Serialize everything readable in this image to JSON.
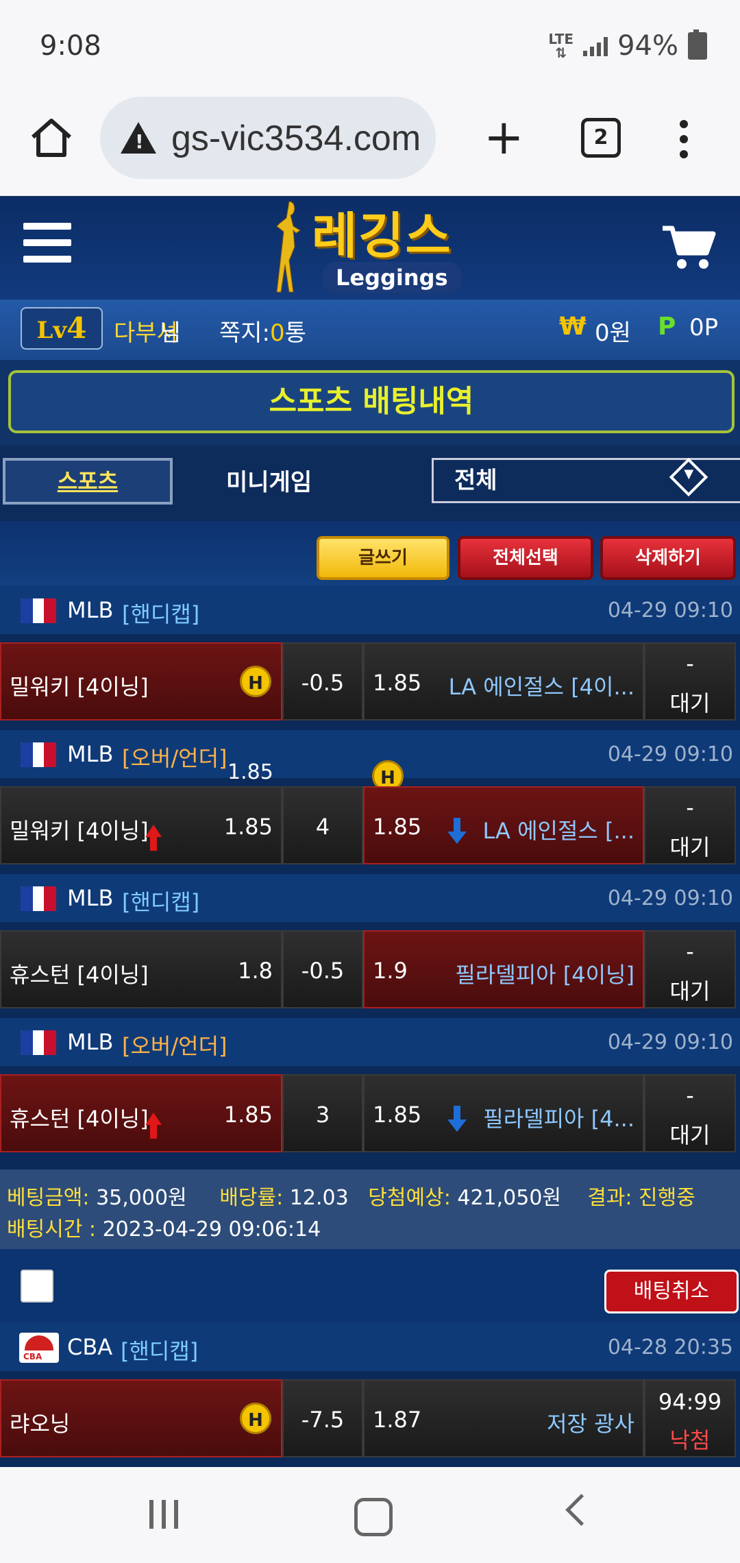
{
  "status": {
    "time": "9:08",
    "network": "LTE",
    "battery": "94%"
  },
  "browser": {
    "url": "gs-vic3534.com",
    "tab_count": "2"
  },
  "site": {
    "logo_kr": "레깅스",
    "logo_en": "Leggings"
  },
  "user": {
    "level_prefix": "Lv",
    "level": "4",
    "name": "다부셔",
    "name_suffix": "님",
    "msg_label": "쪽지:",
    "msg_count": "0",
    "msg_suffix": "통",
    "won_symbol": "₩",
    "money": "0원",
    "point_symbol": "P",
    "points": "0P"
  },
  "page_title": "스포츠 배팅내역",
  "tabs": {
    "sports": "스포츠",
    "minigame": "미니게임",
    "filter": "전체"
  },
  "actions": {
    "write": "글쓰기",
    "select_all": "전체선택",
    "delete": "삭제하기"
  },
  "bets": [
    {
      "league": "MLB",
      "type": "[핸디캡]",
      "type_color": "#7ecbff",
      "time": "04-29 09:10",
      "home": "밀워키 [4이닝]",
      "home_odds": "",
      "line": "-0.5",
      "away_odds": "1.85",
      "away": "LA 에인절스 [4이...",
      "result_top": "-",
      "result": "대기",
      "pick": "home"
    },
    {
      "league": "MLB",
      "type": "[오버/언더]",
      "type_color": "#ffb347",
      "time": "04-29 09:10",
      "extra_odds": "1.85",
      "home": "밀워키 [4이닝]",
      "home_odds": "1.85",
      "line": "4",
      "away_odds": "1.85",
      "away": "LA 에인절스 [...",
      "result_top": "-",
      "result": "대기",
      "pick": "away"
    },
    {
      "league": "MLB",
      "type": "[핸디캡]",
      "type_color": "#7ecbff",
      "time": "04-29 09:10",
      "home": "휴스턴 [4이닝]",
      "home_odds": "1.8",
      "line": "-0.5",
      "away_odds": "1.9",
      "away": "필라델피아 [4이닝]",
      "result_top": "-",
      "result": "대기",
      "pick": "away"
    },
    {
      "league": "MLB",
      "type": "[오버/언더]",
      "type_color": "#ffb347",
      "time": "04-29 09:10",
      "home": "휴스턴 [4이닝]",
      "home_odds": "1.85",
      "line": "3",
      "away_odds": "1.85",
      "away": "필라델피아 [4...",
      "result_top": "-",
      "result": "대기",
      "pick": "home"
    }
  ],
  "summary": {
    "amount_label": "베팅금액:",
    "amount": "35,000원",
    "rate_label": "배당률:",
    "rate": "12.03",
    "win_label": "당첨예상:",
    "win": "421,050원",
    "result_label": "결과:",
    "result": "진행중",
    "time_label": "배팅시간 :",
    "time": "2023-04-29 09:06:14"
  },
  "cancel_label": "배팅취소",
  "bet2": {
    "league": "CBA",
    "type": "[핸디캡]",
    "time": "04-28 20:35",
    "home": "랴오닝",
    "line": "-7.5",
    "away_odds": "1.87",
    "away": "저장 광사",
    "score": "94:99",
    "result": "낙첨"
  },
  "h_badge": "H"
}
